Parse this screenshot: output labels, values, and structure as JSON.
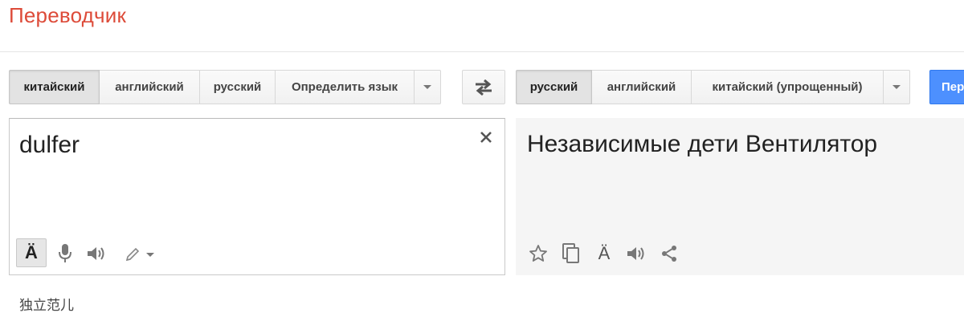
{
  "app": {
    "title": "Переводчик"
  },
  "source_languages": {
    "items": [
      {
        "label": "китайский",
        "selected": true
      },
      {
        "label": "английский",
        "selected": false
      },
      {
        "label": "русский",
        "selected": false
      },
      {
        "label": "Определить язык",
        "selected": false
      }
    ]
  },
  "target_languages": {
    "items": [
      {
        "label": "русский",
        "selected": true
      },
      {
        "label": "английский",
        "selected": false
      },
      {
        "label": "китайский (упрощенный)",
        "selected": false
      }
    ]
  },
  "translate_button": {
    "label": "Пер"
  },
  "source": {
    "text": "dulfer",
    "romanization": "独立范儿",
    "ime_label": "Ä"
  },
  "target": {
    "text": "Независимые дети Вентилятор",
    "romanization_label": "Ä"
  },
  "icons": {
    "clear": "close-icon",
    "microphone": "microphone-icon",
    "speaker": "speaker-icon",
    "handwriting": "pencil-icon",
    "star": "star-icon",
    "copy": "copy-icon",
    "share": "share-icon",
    "swap": "swap-icon"
  },
  "colors": {
    "title": "#dd4b39",
    "translate_button": "#4d90fe"
  }
}
